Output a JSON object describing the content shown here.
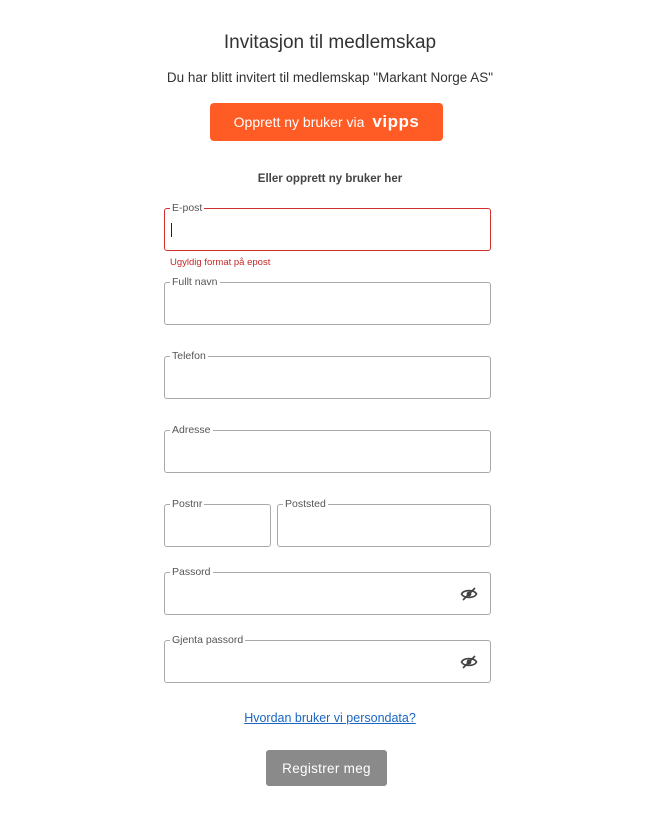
{
  "header": {
    "title": "Invitasjon til medlemskap",
    "subtitle": "Du har blitt invitert til medlemskap \"Markant Norge AS\""
  },
  "vipps": {
    "label": "Opprett ny bruker via",
    "brand": "vipps",
    "color": "#ff5b24"
  },
  "or_label": "Eller opprett ny bruker her",
  "form": {
    "email": {
      "label": "E-post",
      "value": "",
      "error": "Ugyldig format på epost"
    },
    "full_name": {
      "label": "Fullt navn",
      "value": ""
    },
    "phone": {
      "label": "Telefon",
      "value": ""
    },
    "address": {
      "label": "Adresse",
      "value": ""
    },
    "postal_code": {
      "label": "Postnr",
      "value": ""
    },
    "city": {
      "label": "Poststed",
      "value": ""
    },
    "password": {
      "label": "Passord",
      "value": "",
      "icon": "eye-off-icon"
    },
    "password_repeat": {
      "label": "Gjenta passord",
      "value": "",
      "icon": "eye-off-icon"
    }
  },
  "privacy_link": "Hvordan bruker vi persondata?",
  "submit_label": "Registrer meg",
  "colors": {
    "error": "#d32f2f",
    "link": "#1a66c2",
    "submit_bg": "#8a8a8a"
  }
}
